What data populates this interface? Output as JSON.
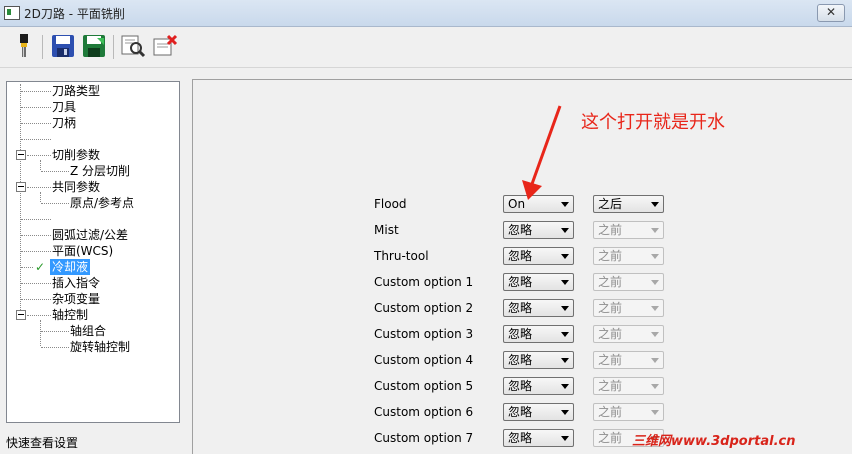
{
  "window": {
    "title": "2D刀路 - 平面铣削",
    "close_glyph": "✕"
  },
  "toolbar": {
    "buttons": [
      {
        "name": "tool-icon"
      },
      {
        "name": "save-icon"
      },
      {
        "name": "save-as-icon"
      },
      {
        "name": "preview-icon"
      },
      {
        "name": "delete-icon"
      }
    ]
  },
  "tree": {
    "items": [
      {
        "label": "刀路类型",
        "level": 1
      },
      {
        "label": "刀具",
        "level": 1
      },
      {
        "label": "刀柄",
        "level": 1
      },
      {
        "label": "",
        "level": 1
      },
      {
        "label": "切削参数",
        "level": 1,
        "expanded": true
      },
      {
        "label": "Z 分层切削",
        "level": 2
      },
      {
        "label": "共同参数",
        "level": 1,
        "expanded": true
      },
      {
        "label": "原点/参考点",
        "level": 2
      },
      {
        "label": "",
        "level": 1
      },
      {
        "label": "圆弧过滤/公差",
        "level": 1
      },
      {
        "label": "平面(WCS)",
        "level": 1
      },
      {
        "label": "冷却液",
        "level": 1,
        "selected": true,
        "checked": true
      },
      {
        "label": "插入指令",
        "level": 1
      },
      {
        "label": "杂项变量",
        "level": 1
      },
      {
        "label": "轴控制",
        "level": 1,
        "expanded": true
      },
      {
        "label": "轴组合",
        "level": 2
      },
      {
        "label": "旋转轴控制",
        "level": 2
      }
    ],
    "check_glyph": "✓"
  },
  "footer": {
    "quick_view": "快速查看设置"
  },
  "coolant": {
    "rows": [
      {
        "label": "Flood",
        "value": "On",
        "timing": "之后",
        "timing_enabled": true
      },
      {
        "label": "Mist",
        "value": "忽略",
        "timing": "之前",
        "timing_enabled": false
      },
      {
        "label": "Thru-tool",
        "value": "忽略",
        "timing": "之前",
        "timing_enabled": false
      },
      {
        "label": "Custom option 1",
        "value": "忽略",
        "timing": "之前",
        "timing_enabled": false
      },
      {
        "label": "Custom option 2",
        "value": "忽略",
        "timing": "之前",
        "timing_enabled": false
      },
      {
        "label": "Custom option 3",
        "value": "忽略",
        "timing": "之前",
        "timing_enabled": false
      },
      {
        "label": "Custom option 4",
        "value": "忽略",
        "timing": "之前",
        "timing_enabled": false
      },
      {
        "label": "Custom option 5",
        "value": "忽略",
        "timing": "之前",
        "timing_enabled": false
      },
      {
        "label": "Custom option 6",
        "value": "忽略",
        "timing": "之前",
        "timing_enabled": false
      },
      {
        "label": "Custom option 7",
        "value": "忽略",
        "timing": "之前",
        "timing_enabled": false
      }
    ]
  },
  "annotation": {
    "text": "这个打开就是开水",
    "color": "#e8261a"
  },
  "watermark": {
    "text": "三维网www.3dportal.cn"
  }
}
